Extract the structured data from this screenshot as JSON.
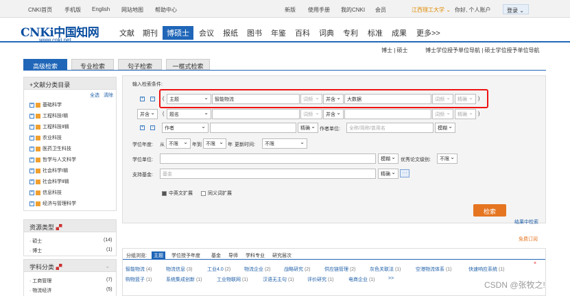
{
  "topbar": {
    "items": [
      "CNKI首页",
      "手机版",
      "English",
      "网站地图",
      "帮助中心",
      "新版",
      "使用手册",
      "我的CNKI",
      "会员"
    ],
    "org": "江西理工大学 ⌄",
    "greeting": "你好, 个人账户",
    "login": "登录 ⌄"
  },
  "logo": {
    "text": "CNKi中国知网",
    "url": "www.cnki.net"
  },
  "nav": [
    "文献",
    "期刊",
    "博硕士",
    "会议",
    "报纸",
    "图书",
    "年鉴",
    "百科",
    "词典",
    "专利",
    "标准",
    "成果",
    "更多>>"
  ],
  "subnav": {
    "left": "博士 | 硕士",
    "right": "博士学位授予单位导航 | 硕士学位授予单位导航"
  },
  "tabs": [
    "高级检索",
    "专业检索",
    "句子检索",
    "一框式检索"
  ],
  "sidebar": {
    "classify_title": "文献分类目录",
    "select_all": "全选",
    "clear": "清除",
    "categories": [
      "基础科学",
      "工程科技Ⅰ辑",
      "工程科技Ⅱ辑",
      "农业科技",
      "医药卫生科技",
      "哲学与人文科学",
      "社会科学Ⅰ辑",
      "社会科学Ⅱ辑",
      "信息科技",
      "经济与管理科学"
    ],
    "resource_title": "资源类型",
    "resources": [
      {
        "label": "硕士",
        "count": "(14)"
      },
      {
        "label": "博士",
        "count": "(1)"
      }
    ],
    "subject_title": "学科分类",
    "subjects": [
      {
        "label": "工商管理",
        "count": "(7)"
      },
      {
        "label": "物流经济",
        "count": "(5)"
      }
    ]
  },
  "form": {
    "condition_label": "输入检索条件:",
    "row1": {
      "paren_open": "(",
      "field": "主题",
      "value": "智能物流",
      "freq": "词频",
      "logic": "并含",
      "value2": "大数据",
      "freq2": "词频",
      "match": "精确",
      "paren_close": ")"
    },
    "row2": {
      "logic_outer": "并含",
      "paren_open": "(",
      "field": "题名",
      "freq": "词频",
      "logic": "并含",
      "freq2": "词频",
      "match": "精确",
      "paren_close": ")"
    },
    "row3": {
      "field": "作者",
      "match": "精确",
      "unit_label": "作者单位:",
      "unit_placeholder": "全称/简称/曾用名",
      "unit_match": "模糊"
    },
    "year": {
      "label": "学位年度:",
      "from": "从",
      "from_val": "不限",
      "to": "年到",
      "to_val": "不限",
      "suffix": "年",
      "update_label": "更新时间:",
      "update_val": "不限"
    },
    "degree_unit": {
      "label": "学位单位:",
      "match": "模糊",
      "excellent_label": "优秀论文级别:",
      "excellent_val": "不限"
    },
    "fund": {
      "label": "支持基金:",
      "placeholder": "基金",
      "match": "精确",
      "dots": "···"
    },
    "ext": {
      "cn_en": "中英文扩展",
      "synonym": "同义词扩展"
    },
    "search_button": "检索",
    "search_in_results": "结果中检索"
  },
  "free_order": "免费订阅",
  "results": {
    "group_label": "分组浏览:",
    "tabs": [
      "主题",
      "学位授予年度",
      "基金",
      "导师",
      "学科专业",
      "研究层次"
    ],
    "close": "×",
    "keywords_row1": [
      {
        "t": "智能物流",
        "c": "(4)"
      },
      {
        "t": "物流信息",
        "c": "(3)"
      },
      {
        "t": "工业4.0",
        "c": "(2)"
      },
      {
        "t": "物流企业",
        "c": "(2)"
      },
      {
        "t": "战略研究",
        "c": "(2)"
      },
      {
        "t": "供应链管理",
        "c": "(2)"
      },
      {
        "t": "灰色关联法",
        "c": "(1)"
      },
      {
        "t": "空港物流体系",
        "c": "(1)"
      },
      {
        "t": "快速响应系统",
        "c": "(1)"
      }
    ],
    "keywords_row2": [
      {
        "t": "购物篮子",
        "c": "(1)"
      },
      {
        "t": "系统集成创新",
        "c": "(1)"
      },
      {
        "t": "工业物联网",
        "c": "(1)"
      },
      {
        "t": "汉语无主句",
        "c": "(1)"
      },
      {
        "t": "评价研究",
        "c": "(1)"
      },
      {
        "t": "电商企业",
        "c": "(1)"
      },
      {
        "t": ">>",
        "c": ""
      }
    ]
  },
  "watermark": "CSDN @张牧之!"
}
